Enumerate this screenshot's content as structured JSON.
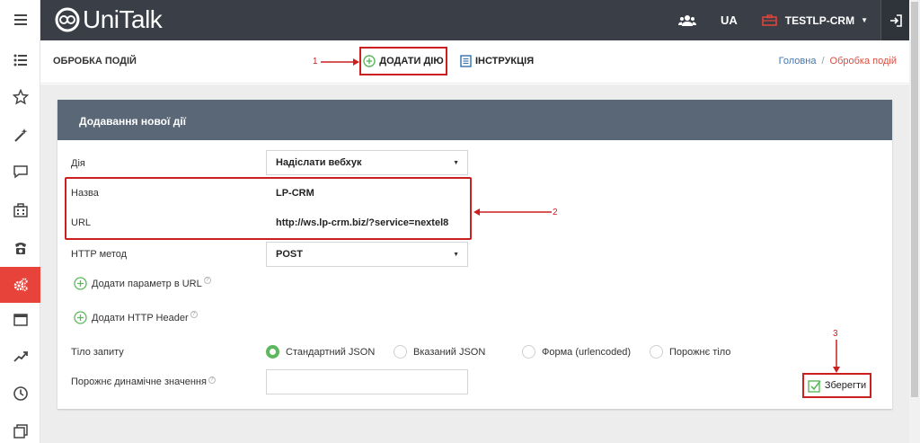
{
  "app": {
    "logo_text": "UniTalk",
    "language": "UA",
    "company": "TESTLP-CRM"
  },
  "subheader": {
    "page_title": "ОБРОБКА ПОДІЙ",
    "add_action_label": "ДОДАТИ ДІЮ",
    "instruction_label": "ІНСТРУКЦІЯ",
    "breadcrumb": {
      "home": "Головна",
      "separator": "/",
      "current": "Обробка подій"
    }
  },
  "annotations": {
    "a1": "1",
    "a2": "2",
    "a3": "3"
  },
  "form": {
    "panel_title": "Додавання нової дії",
    "action_label": "Дія",
    "action_value": "Надіслати вебхук",
    "name_label": "Назва",
    "name_value": "LP-CRM",
    "url_label": "URL",
    "url_value": "http://ws.lp-crm.biz/?service=nextel8",
    "method_label": "HTTP метод",
    "method_value": "POST",
    "add_param_label": "Додати параметр в URL",
    "add_header_label": "Додати HTTP Header",
    "body_label": "Тіло запиту",
    "body_options": [
      "Стандартний JSON",
      "Вказаний JSON",
      "Форма (urlencoded)",
      "Порожнє тіло"
    ],
    "body_selected": "Стандартний JSON",
    "empty_value_label": "Порожнє динамічне значення",
    "empty_value": "",
    "save_label": "Зберегти",
    "help_glyph": "?"
  },
  "colors": {
    "topbar": "#3a3f47",
    "panel_header": "#5a6776",
    "accent_red": "#e8433a",
    "annotation_red": "#cc1f1f",
    "green": "#5cb85c",
    "link_blue": "#3d78b3"
  },
  "sidebar_icons": [
    "menu-icon",
    "list-icon",
    "star-icon",
    "magic-wand-icon",
    "chat-icon",
    "building-icon",
    "phone-icon",
    "gears-icon",
    "window-icon",
    "trend-icon",
    "clock-icon",
    "copy-icon"
  ],
  "active_sidebar_icon": "gears-icon"
}
